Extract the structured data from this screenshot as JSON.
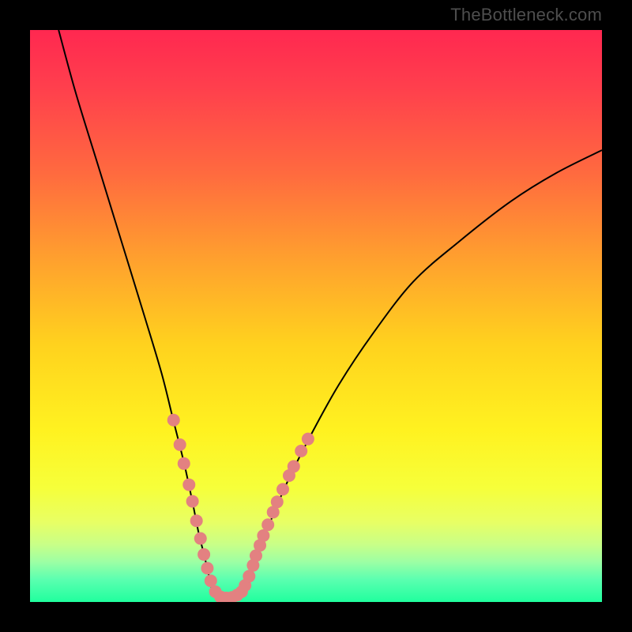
{
  "watermark": "TheBottleneck.com",
  "colors": {
    "frame": "#000000",
    "curve": "#000000",
    "dot_fill": "#e38181",
    "dot_stroke": "#b65a5a",
    "gradient_stops": [
      {
        "offset": 0.0,
        "color": "#ff2850"
      },
      {
        "offset": 0.1,
        "color": "#ff3f4d"
      },
      {
        "offset": 0.25,
        "color": "#ff6a3f"
      },
      {
        "offset": 0.4,
        "color": "#ffa02e"
      },
      {
        "offset": 0.55,
        "color": "#ffd21e"
      },
      {
        "offset": 0.7,
        "color": "#fff220"
      },
      {
        "offset": 0.8,
        "color": "#f6ff3a"
      },
      {
        "offset": 0.86,
        "color": "#e8ff64"
      },
      {
        "offset": 0.9,
        "color": "#c8ff88"
      },
      {
        "offset": 0.93,
        "color": "#9cffa4"
      },
      {
        "offset": 0.96,
        "color": "#5cffb0"
      },
      {
        "offset": 1.0,
        "color": "#20ff9e"
      }
    ]
  },
  "chart_data": {
    "type": "line",
    "title": "",
    "xlabel": "",
    "ylabel": "",
    "xlim": [
      0,
      100
    ],
    "ylim": [
      0,
      100
    ],
    "series": [
      {
        "name": "left-branch",
        "x": [
          5,
          8,
          12,
          16,
          20,
          23,
          25,
          27,
          28.5,
          29.5,
          30.5,
          31.3,
          31.9
        ],
        "values": [
          100,
          89,
          76,
          63,
          50,
          40,
          32,
          24,
          17,
          12,
          8,
          4.5,
          2
        ]
      },
      {
        "name": "bottom-branch",
        "x": [
          31.9,
          32.8,
          33.8,
          34.8,
          35.8,
          36.7,
          37.4
        ],
        "values": [
          2,
          1.2,
          0.8,
          0.7,
          0.9,
          1.4,
          2.2
        ]
      },
      {
        "name": "right-branch",
        "x": [
          37.4,
          38.5,
          40,
          42,
          45,
          49,
          54,
          60,
          67,
          75,
          84,
          92,
          100
        ],
        "values": [
          2.2,
          5,
          9,
          14,
          21,
          29,
          38,
          47,
          56,
          63,
          70,
          75,
          79
        ]
      }
    ],
    "dots": [
      {
        "x": 25.1,
        "y": 31.8
      },
      {
        "x": 26.2,
        "y": 27.5
      },
      {
        "x": 26.9,
        "y": 24.2
      },
      {
        "x": 27.8,
        "y": 20.5
      },
      {
        "x": 28.4,
        "y": 17.6
      },
      {
        "x": 29.1,
        "y": 14.2
      },
      {
        "x": 29.8,
        "y": 11.1
      },
      {
        "x": 30.4,
        "y": 8.3
      },
      {
        "x": 31.0,
        "y": 5.9
      },
      {
        "x": 31.6,
        "y": 3.7
      },
      {
        "x": 32.4,
        "y": 1.8
      },
      {
        "x": 33.3,
        "y": 0.9
      },
      {
        "x": 34.3,
        "y": 0.7
      },
      {
        "x": 35.3,
        "y": 0.8
      },
      {
        "x": 36.2,
        "y": 1.2
      },
      {
        "x": 37.0,
        "y": 1.8
      },
      {
        "x": 37.6,
        "y": 2.9
      },
      {
        "x": 38.3,
        "y": 4.5
      },
      {
        "x": 39.0,
        "y": 6.4
      },
      {
        "x": 39.5,
        "y": 8.1
      },
      {
        "x": 40.2,
        "y": 9.9
      },
      {
        "x": 40.8,
        "y": 11.6
      },
      {
        "x": 41.6,
        "y": 13.5
      },
      {
        "x": 42.5,
        "y": 15.7
      },
      {
        "x": 43.2,
        "y": 17.5
      },
      {
        "x": 44.2,
        "y": 19.7
      },
      {
        "x": 45.3,
        "y": 22.1
      },
      {
        "x": 46.1,
        "y": 23.7
      },
      {
        "x": 47.4,
        "y": 26.4
      },
      {
        "x": 48.6,
        "y": 28.5
      }
    ]
  }
}
